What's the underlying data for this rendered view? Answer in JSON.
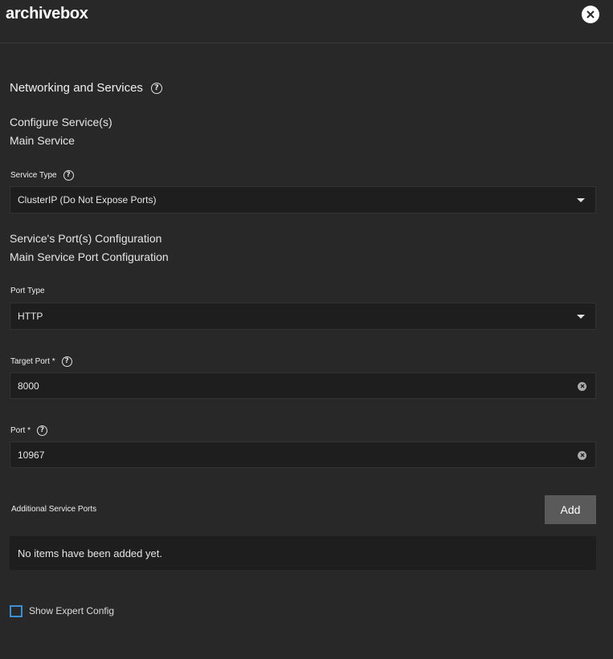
{
  "header": {
    "title": "archivebox",
    "close_icon": "close-icon"
  },
  "section": {
    "title": "Networking and Services",
    "help_icon": "help-circle-icon"
  },
  "service": {
    "configure_label": "Configure Service(s)",
    "main_label": "Main Service",
    "type_label": "Service Type",
    "type_value": "ClusterIP (Do Not Expose Ports)"
  },
  "ports": {
    "config_label": "Service's Port(s) Configuration",
    "main_config_label": "Main Service Port Configuration",
    "port_type_label": "Port Type",
    "port_type_value": "HTTP",
    "target_port_label": "Target Port *",
    "target_port_value": "8000",
    "port_label": "Port *",
    "port_value": "10967"
  },
  "additional": {
    "label": "Additional Service Ports",
    "add_button": "Add",
    "empty_text": "No items have been added yet."
  },
  "expert": {
    "label": "Show Expert Config",
    "checked": false
  },
  "colors": {
    "background": "#282828",
    "field": "#1e1e1e",
    "checkbox_border": "#3a8fd6"
  }
}
